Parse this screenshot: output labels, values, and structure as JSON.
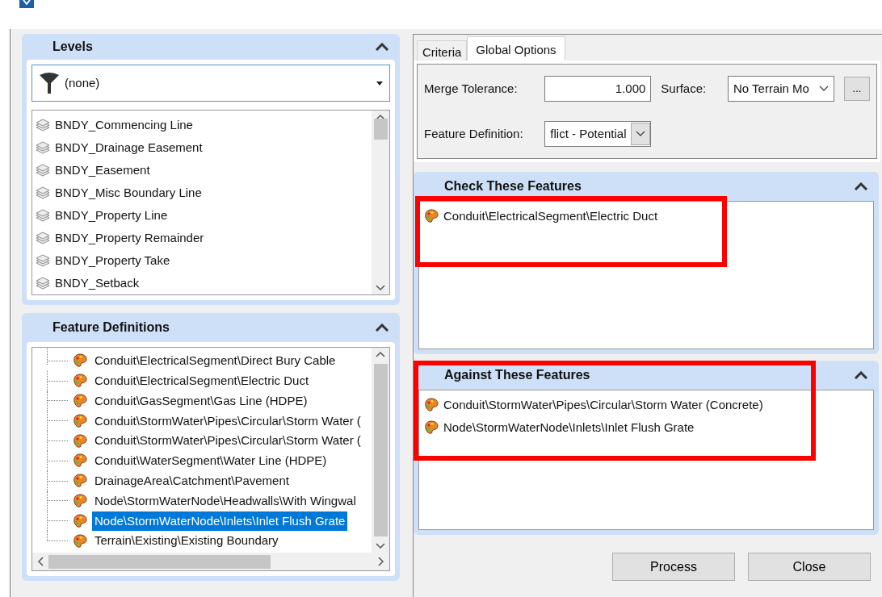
{
  "levels": {
    "title": "Levels",
    "filter": "(none)",
    "items": [
      {
        "label": "BNDY_Commencing Line"
      },
      {
        "label": "BNDY_Drainage Easement"
      },
      {
        "label": "BNDY_Easement"
      },
      {
        "label": "BNDY_Misc Boundary Line"
      },
      {
        "label": "BNDY_Property Line"
      },
      {
        "label": "BNDY_Property Remainder"
      },
      {
        "label": "BNDY_Property Take"
      },
      {
        "label": "BNDY_Setback"
      }
    ]
  },
  "feature_definitions": {
    "title": "Feature Definitions",
    "items": [
      {
        "label": "Conduit\\ElectricalSegment\\Direct Bury Cable",
        "selected": false
      },
      {
        "label": "Conduit\\ElectricalSegment\\Electric Duct",
        "selected": false
      },
      {
        "label": "Conduit\\GasSegment\\Gas Line (HDPE)",
        "selected": false
      },
      {
        "label": "Conduit\\StormWater\\Pipes\\Circular\\Storm Water (",
        "selected": false
      },
      {
        "label": "Conduit\\StormWater\\Pipes\\Circular\\Storm Water (",
        "selected": false
      },
      {
        "label": "Conduit\\WaterSegment\\Water Line (HDPE)",
        "selected": false
      },
      {
        "label": "DrainageArea\\Catchment\\Pavement",
        "selected": false
      },
      {
        "label": "Node\\StormWaterNode\\Headwalls\\With Wingwal",
        "selected": false
      },
      {
        "label": "Node\\StormWaterNode\\Inlets\\Inlet Flush Grate",
        "selected": true
      },
      {
        "label": "Terrain\\Existing\\Existing Boundary",
        "selected": false
      }
    ]
  },
  "tabs": [
    {
      "label": "Criteria",
      "selected": false
    },
    {
      "label": "Global Options",
      "selected": true
    }
  ],
  "options": {
    "merge_tolerance_label": "Merge Tolerance:",
    "merge_tolerance": "1.000",
    "surface_label": "Surface:",
    "surface": "No Terrain Mo",
    "browse_button": "...",
    "feature_definition_label": "Feature Definition:",
    "feature_definition": "flict - Potential"
  },
  "check_features": {
    "title": "Check These Features",
    "highlighted": true,
    "items": [
      {
        "label": "Conduit\\ElectricalSegment\\Electric Duct"
      }
    ]
  },
  "against_features": {
    "title": "Against These Features",
    "highlighted": true,
    "items": [
      {
        "label": "Conduit\\StormWater\\Pipes\\Circular\\Storm Water (Concrete)"
      },
      {
        "label": "Node\\StormWaterNode\\Inlets\\Inlet Flush Grate"
      }
    ]
  },
  "buttons": [
    "Process",
    "Close"
  ]
}
